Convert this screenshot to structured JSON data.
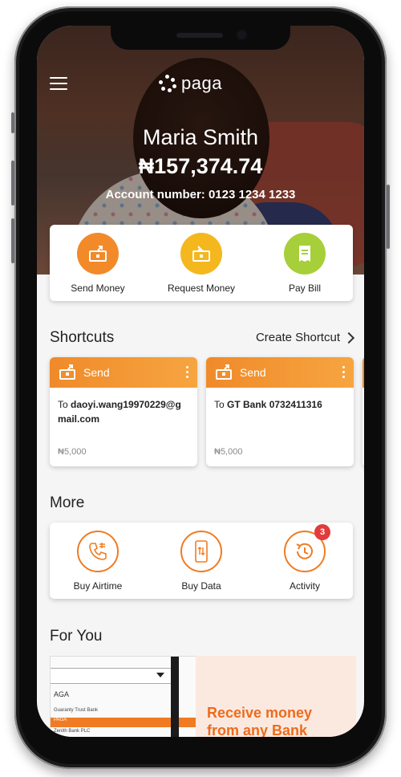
{
  "header": {
    "logo_text": "paga",
    "user_name": "Maria Smith",
    "balance": "₦157,374.74",
    "account_number": "Account number: 0123 1234 1233"
  },
  "actions": [
    {
      "label": "Send Money",
      "icon": "send-money-icon",
      "color": "#f28a2a"
    },
    {
      "label": "Request Money",
      "icon": "request-money-icon",
      "color": "#f4b71e"
    },
    {
      "label": "Pay Bill",
      "icon": "bill-icon",
      "color": "#a6cf3a"
    }
  ],
  "shortcuts": {
    "title": "Shortcuts",
    "create_label": "Create Shortcut",
    "cards": [
      {
        "type": "Send",
        "to_prefix": "To ",
        "recipient": "daoyi.wang19970229@gmail.com",
        "amount": "₦5,000"
      },
      {
        "type": "Send",
        "to_prefix": "To ",
        "recipient": "GT Bank 0732411316",
        "amount": "₦5,000"
      }
    ]
  },
  "more": {
    "title": "More",
    "items": [
      {
        "label": "Buy Airtime",
        "icon": "phone-icon"
      },
      {
        "label": "Buy Data",
        "icon": "mobile-data-icon"
      },
      {
        "label": "Activity",
        "icon": "history-icon",
        "badge": "3"
      }
    ]
  },
  "for_you": {
    "title": "For You",
    "promo_text_line1": "Receive money",
    "promo_text_line2": "from any Bank",
    "promo_list": [
      "AGA",
      "Guaranty Trust Bank",
      "PAGA",
      "Zenith Bank PLC"
    ]
  },
  "colors": {
    "brand_orange": "#f07b22",
    "accent_yellow": "#f4b71e",
    "accent_green": "#a6cf3a",
    "badge_red": "#e23b3b"
  }
}
